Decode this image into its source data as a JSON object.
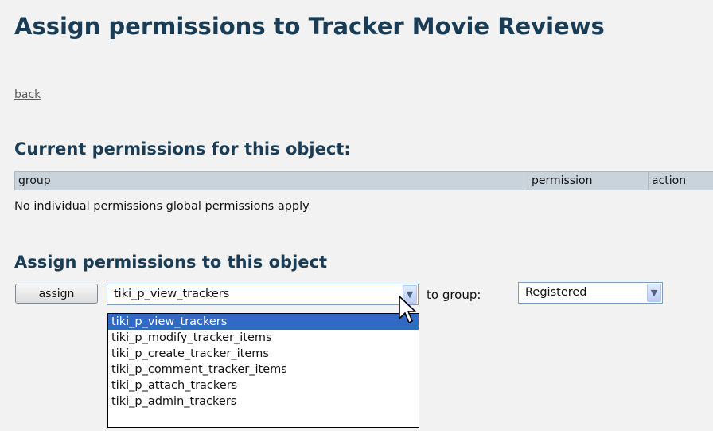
{
  "page": {
    "title": "Assign permissions to Tracker Movie Reviews",
    "back_link": "back"
  },
  "current": {
    "heading": "Current permissions for this object:",
    "columns": [
      "group",
      "permission",
      "action"
    ],
    "empty_message": "No individual permissions global permissions apply"
  },
  "assign": {
    "heading": "Assign permissions to this object",
    "button_label": "assign",
    "permission_select": {
      "value": "tiki_p_view_trackers",
      "options": [
        "tiki_p_view_trackers",
        "tiki_p_modify_tracker_items",
        "tiki_p_create_tracker_items",
        "tiki_p_comment_tracker_items",
        "tiki_p_attach_trackers",
        "tiki_p_admin_trackers"
      ],
      "highlighted_option": "tiki_p_view_trackers"
    },
    "to_group_label": "to group:",
    "group_select": {
      "value": "Registered"
    }
  },
  "icons": {
    "dropdown_arrow": "chevron-down-icon",
    "cursor": "mouse-pointer-icon"
  },
  "colors": {
    "heading": "#1a3d57",
    "table_header": "#c9d3dc",
    "selection": "#316ac5",
    "background": "#f2f2f2"
  }
}
